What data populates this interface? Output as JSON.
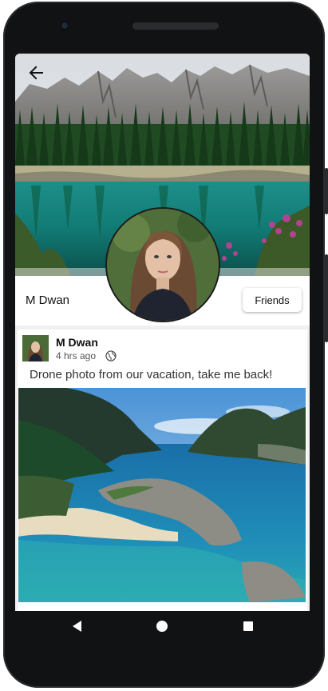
{
  "profile": {
    "name": "M Dwan",
    "friends_button_label": "Friends"
  },
  "post": {
    "author": "M Dwan",
    "time": "4 hrs ago",
    "text": "Drone photo from our vacation, take me back!"
  },
  "icons": {
    "back": "arrow-back-icon",
    "privacy": "globe-icon",
    "nav_back": "triangle-back-icon",
    "nav_home": "circle-home-icon",
    "nav_recent": "square-recent-icon"
  },
  "colors": {
    "screen_bg": "#f0f0f0",
    "card_bg": "#ffffff",
    "text_primary": "#111111",
    "text_secondary": "#555555",
    "device_frame": "#111214"
  }
}
